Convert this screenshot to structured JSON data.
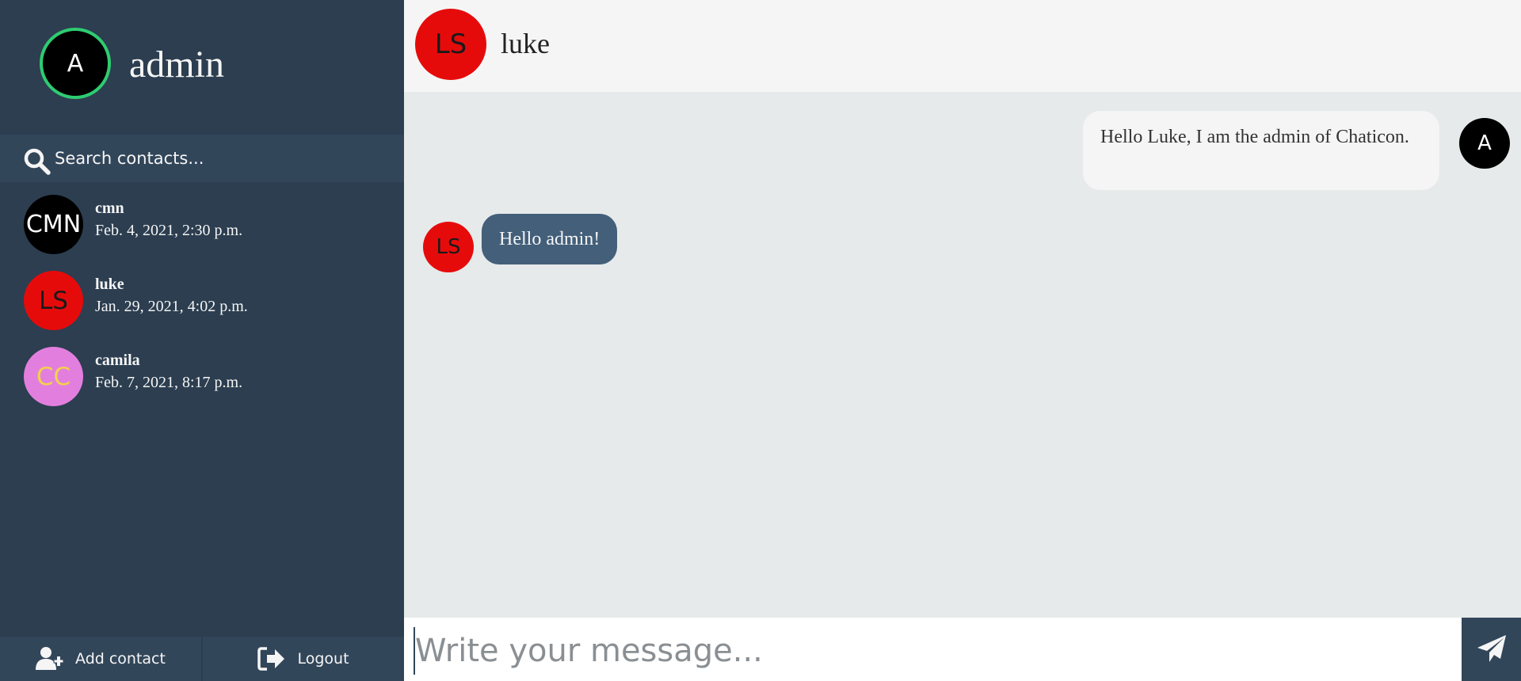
{
  "sidebar": {
    "profile": {
      "initials": "A",
      "name": "admin",
      "status_color": "#2ecc71"
    },
    "search": {
      "placeholder": "Search contacts..."
    },
    "contacts": [
      {
        "initials": "CMN",
        "name": "cmn",
        "time": "Feb. 4, 2021, 2:30 p.m.",
        "bg": "#000000",
        "fg": "#ffffff"
      },
      {
        "initials": "LS",
        "name": "luke",
        "time": "Jan. 29, 2021, 4:02 p.m.",
        "bg": "#e60b0b",
        "fg": "#1a1a1a"
      },
      {
        "initials": "CC",
        "name": "camila",
        "time": "Feb. 7, 2021, 8:17 p.m.",
        "bg": "#e27fde",
        "fg": "#f2d14a"
      }
    ],
    "bottom": {
      "add_contact_label": "Add contact",
      "logout_label": "Logout",
      "add_contact_icon": "user-plus-icon",
      "logout_icon": "sign-out-icon"
    }
  },
  "header": {
    "initials": "LS",
    "name": "luke"
  },
  "messages": [
    {
      "direction": "sent",
      "initials": "A",
      "text": "Hello Luke, I am the admin of Chaticon."
    },
    {
      "direction": "received",
      "initials": "LS",
      "text": "Hello admin!"
    }
  ],
  "composer": {
    "placeholder": "Write your message...",
    "send_icon": "paper-plane-icon"
  },
  "colors": {
    "sidebar_bg": "#2c3e50",
    "search_bg": "#32465a",
    "received_bubble": "#435f7a",
    "chat_bg": "#e6eaea",
    "online_ring": "#2ecc71"
  }
}
